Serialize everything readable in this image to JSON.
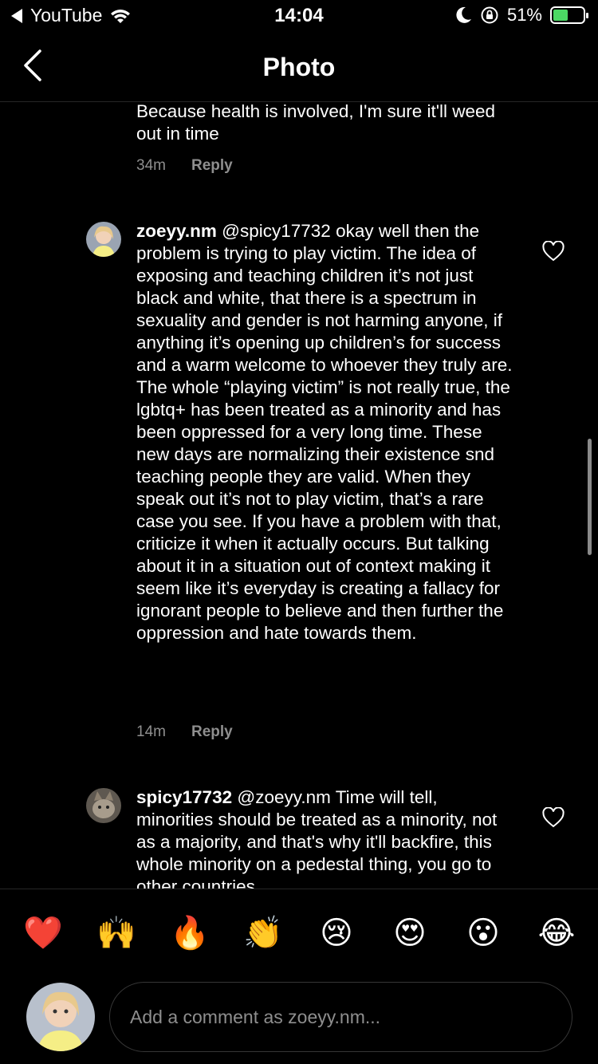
{
  "status_bar": {
    "back_app": "YouTube",
    "time": "14:04",
    "battery": "51%",
    "battery_level": 0.51
  },
  "nav": {
    "title": "Photo"
  },
  "comments": [
    {
      "text": "Because health is involved, I'm sure it'll weed out in time",
      "time": "34m",
      "reply_label": "Reply"
    },
    {
      "username": "zoeyy.nm",
      "mention": "@spicy17732",
      "text": "okay well then the problem is trying to play victim. The idea of exposing and teaching children it’s not just black and white, that there is a spectrum in sexuality and gender is not harming anyone, if anything it’s opening up children’s for success and a warm welcome to whoever they truly are. The whole “playing victim” is not really true, the lgbtq+ has been treated as a minority and has been oppressed for a very long time. These new days are normalizing their existence snd teaching people they are valid. When they speak out it’s not to play victim, that’s a rare case you see. If you have a problem with that, criticize it when it actually occurs. But talking about it in a situation out of context making it seem like it’s everyday is creating a fallacy for ignorant people to believe and then further the oppression and hate towards them.",
      "time": "14m",
      "reply_label": "Reply"
    },
    {
      "username": "spicy17732",
      "mention": "@zoeyy.nm",
      "text": "Time will tell, minorities should be treated as a minority, not as a majority, and that's why it'll backfire, this whole minority on a pedestal thing, you go to other countries"
    }
  ],
  "reactions": [
    "❤️",
    "🙌",
    "🔥",
    "👏",
    "😢",
    "😍",
    "😮",
    "😂"
  ],
  "comment_input": {
    "placeholder": "Add a comment as zoeyy.nm..."
  }
}
